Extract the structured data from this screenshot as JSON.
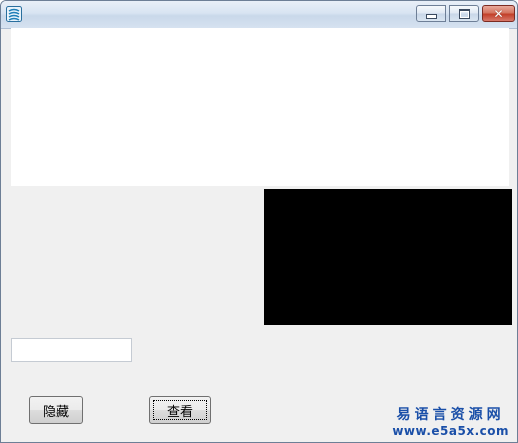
{
  "window": {
    "title": "",
    "caption_buttons": {
      "minimize_glyph": "",
      "maximize_glyph": "",
      "close_glyph": "✕"
    },
    "icon": "app-logo-icon"
  },
  "main_textbox": {
    "value": ""
  },
  "small_input": {
    "value": "",
    "placeholder": ""
  },
  "buttons": {
    "hide_label": "隐藏",
    "view_label": "查看"
  },
  "watermark": {
    "line1": "易语言资源网",
    "line2": "www.e5a5x.com"
  },
  "colors": {
    "panel_black": "#000000",
    "watermark_blue": "#1a4fa8",
    "window_bg": "#f0f0f0"
  }
}
